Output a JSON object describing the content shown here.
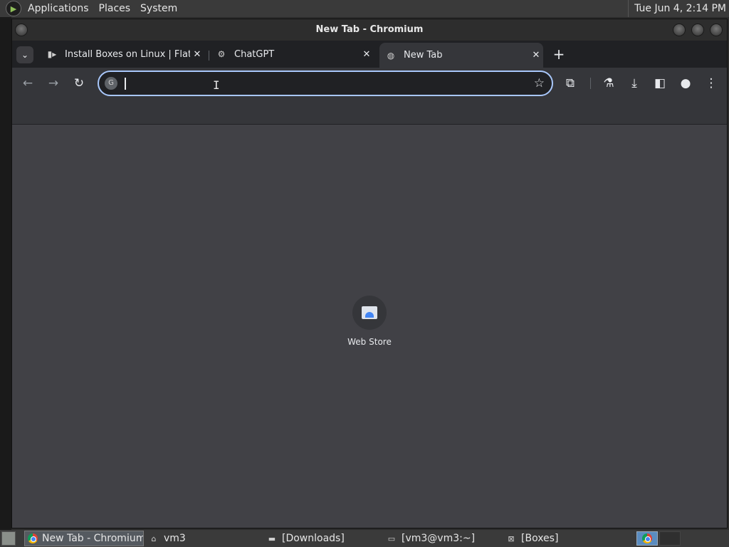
{
  "top_panel": {
    "menus": [
      "Applications",
      "Places",
      "System"
    ],
    "clock": "Tue Jun  4,  2:14 PM"
  },
  "window": {
    "title": "New Tab - Chromium"
  },
  "tabs": [
    {
      "title": "Install Boxes on Linux | Flathub",
      "icon": "flathub-icon",
      "active": false
    },
    {
      "title": "ChatGPT",
      "icon": "openai-icon",
      "active": false
    },
    {
      "title": "New Tab",
      "icon": "globe-icon",
      "active": true
    }
  ],
  "toolbar": {
    "omnibox_value": "",
    "icons": [
      "back-icon",
      "forward-icon",
      "reload-icon",
      "bookmark-star-icon",
      "extensions-icon",
      "labs-flask-icon",
      "download-icon",
      "side-panel-icon",
      "profile-icon",
      "more-menu-icon"
    ]
  },
  "content": {
    "shortcuts": [
      {
        "label": "Web Store",
        "icon": "web-store-icon"
      }
    ]
  },
  "taskbar": {
    "tasks": [
      {
        "label": "New Tab - Chromium",
        "icon": "chromium-icon",
        "active": true
      },
      {
        "label": "vm3",
        "icon": "home-folder-icon",
        "active": false
      },
      {
        "label": "[Downloads]",
        "icon": "folder-icon",
        "active": false
      },
      {
        "label": "[vm3@vm3:~]",
        "icon": "terminal-icon",
        "active": false
      },
      {
        "label": "[Boxes]",
        "icon": "boxes-icon",
        "active": false
      }
    ]
  }
}
